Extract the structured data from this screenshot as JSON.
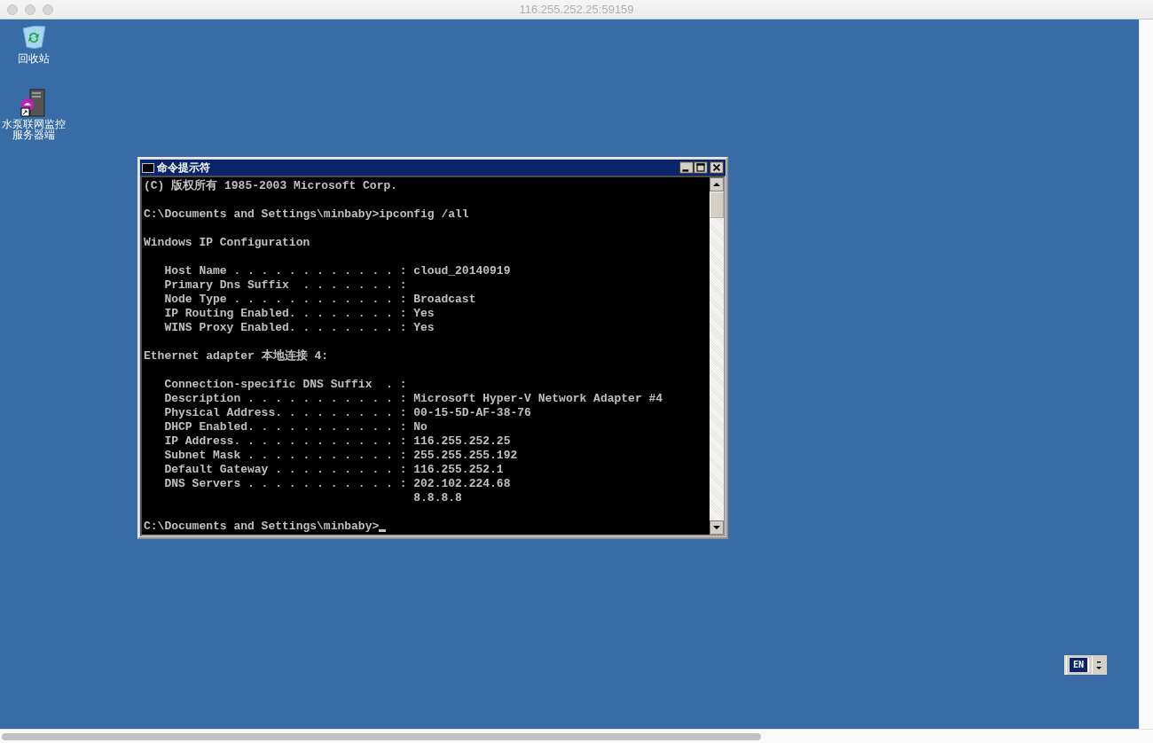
{
  "window": {
    "title": "116.255.252.25:59159"
  },
  "desktop_icons": [
    {
      "kind": "recycle",
      "label": "回收站"
    },
    {
      "kind": "server",
      "label": "水泵联网监控服务器端"
    }
  ],
  "console": {
    "title": "命令提示符",
    "paragraphs": [
      [
        "(C) 版权所有 1985-2003 Microsoft Corp."
      ],
      [
        "C:\\Documents and Settings\\minbaby>ipconfig /all"
      ],
      [
        "Windows IP Configuration"
      ],
      [
        "   Host Name . . . . . . . . . . . . : cloud_20140919",
        "   Primary Dns Suffix  . . . . . . . :",
        "   Node Type . . . . . . . . . . . . : Broadcast",
        "   IP Routing Enabled. . . . . . . . : Yes",
        "   WINS Proxy Enabled. . . . . . . . : Yes"
      ],
      [
        "Ethernet adapter 本地连接 4:"
      ],
      [
        "   Connection-specific DNS Suffix  . :",
        "   Description . . . . . . . . . . . : Microsoft Hyper-V Network Adapter #4",
        "   Physical Address. . . . . . . . . : 00-15-5D-AF-38-76",
        "   DHCP Enabled. . . . . . . . . . . : No",
        "   IP Address. . . . . . . . . . . . : 116.255.252.25",
        "   Subnet Mask . . . . . . . . . . . : 255.255.255.192",
        "   Default Gateway . . . . . . . . . : 116.255.252.1",
        "   DNS Servers . . . . . . . . . . . : 202.102.224.68",
        "                                       8.8.8.8"
      ],
      [
        "C:\\Documents and Settings\\minbaby>"
      ]
    ],
    "cursor": true
  },
  "language_bar": {
    "label": "EN"
  }
}
